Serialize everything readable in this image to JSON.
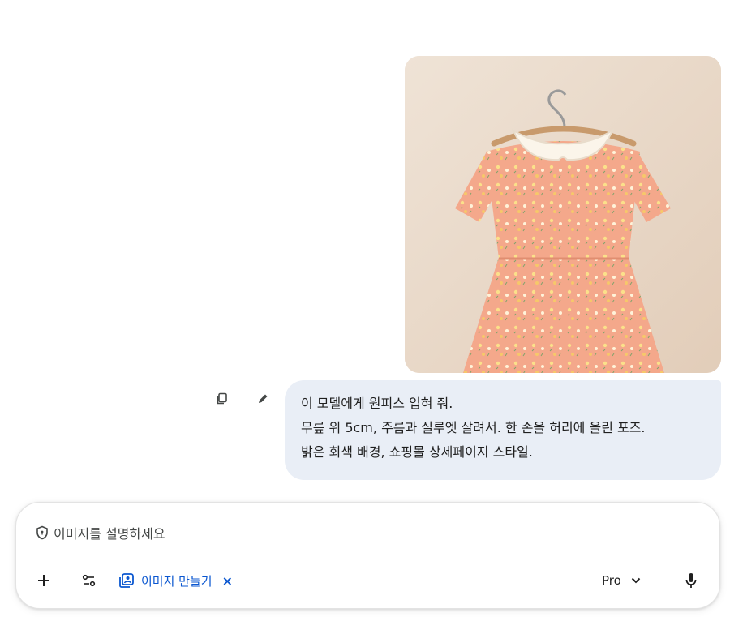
{
  "conversation": {
    "user_message": {
      "image_alt": "peach floral dress with white collar on hanger",
      "lines": [
        "이 모델에게 원피스 입혀 줘.",
        "무릎 위 5cm, 주름과 실루엣 살려서. 한 손을 허리에 올린 포즈.",
        "밝은 회색 배경, 쇼핑몰 상세페이지 스타일."
      ],
      "actions": [
        {
          "name": "copy",
          "icon": "copy-icon"
        },
        {
          "name": "edit",
          "icon": "pencil-icon"
        }
      ]
    }
  },
  "input": {
    "placeholder": "이미지를 설명하세요",
    "tools": {
      "add_icon": "plus-icon",
      "tools_icon": "tune-icon",
      "chip_label": "이미지 만들기",
      "chip_close": "×"
    },
    "model": {
      "label": "Pro"
    },
    "mic_icon": "mic-icon"
  },
  "colors": {
    "bubble": "#e9eef6",
    "chip": "#0b57d0",
    "dress": "#f2a88a"
  }
}
